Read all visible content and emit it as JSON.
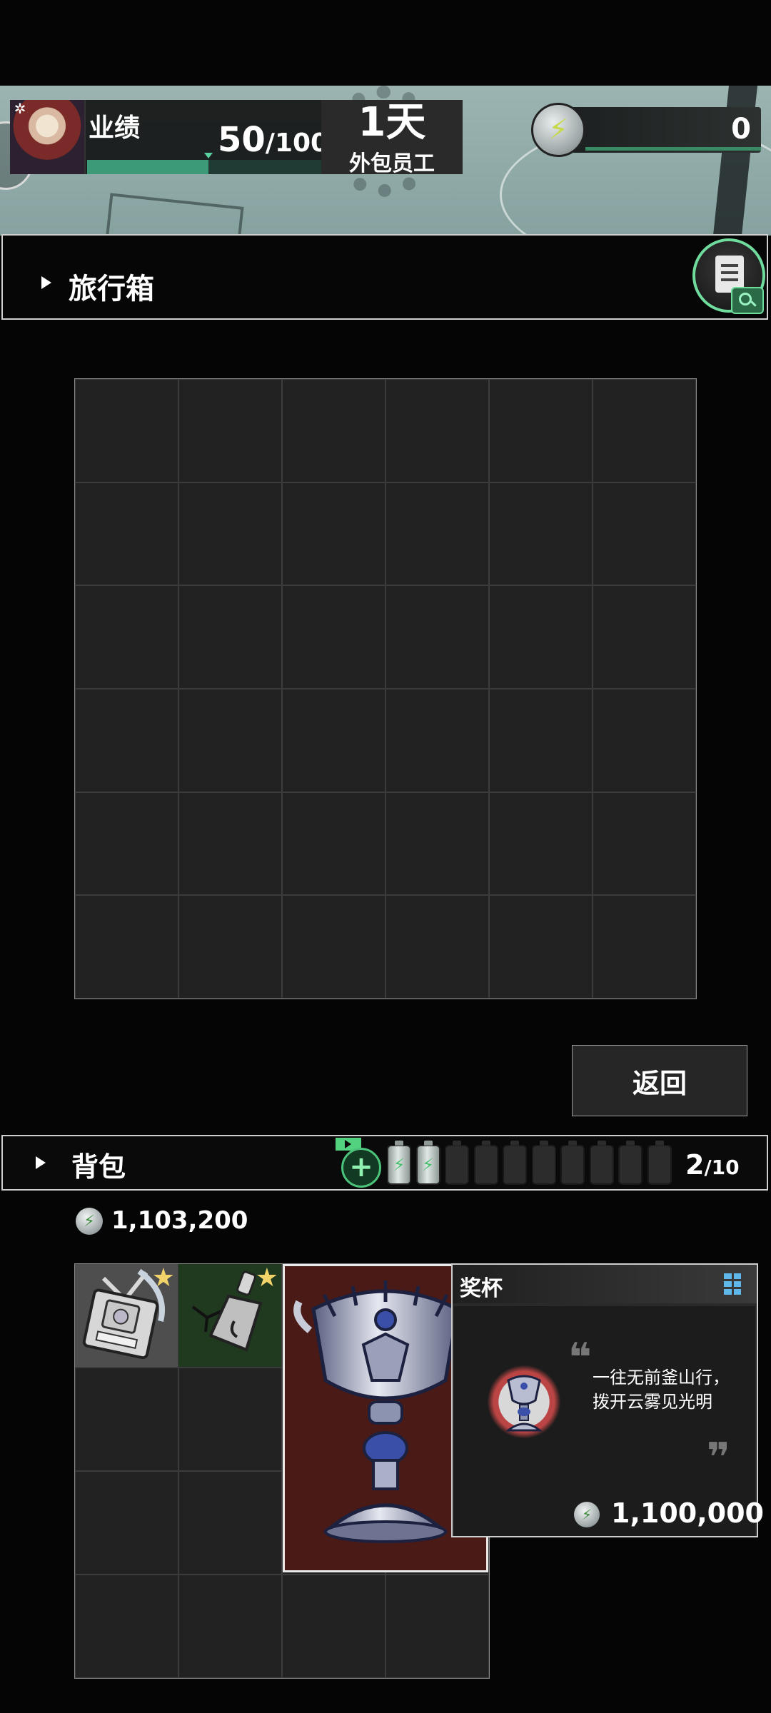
{
  "hud": {
    "performance_label": "业绩",
    "performance_value": "50",
    "performance_max": "/100",
    "performance_progress": 0.5,
    "day_value": "1天",
    "role": "外包员工",
    "energy_value": "0"
  },
  "suitcase": {
    "title": "旅行箱",
    "grid_rows": 6,
    "grid_cols": 6
  },
  "back_button": "返回",
  "backpack": {
    "title": "背包",
    "slots_used": "2",
    "slots_total": "/10",
    "batteries": [
      "full",
      "full",
      "empty",
      "empty",
      "empty",
      "empty",
      "empty",
      "empty",
      "empty",
      "empty"
    ],
    "money": "1,103,200",
    "grid_rows": 4,
    "grid_cols": 4,
    "items": [
      {
        "name": "工作证",
        "starred": true
      },
      {
        "name": "bell-item",
        "starred": true
      },
      {
        "name": "奖杯",
        "starred": false
      }
    ]
  },
  "tooltip": {
    "title": "奖杯",
    "quote_line1": "一往无前釜山行，",
    "quote_line2": "拨开云雾见光明",
    "price": "1,100,000"
  },
  "colors": {
    "accent_green": "#4cc37a",
    "progress_green": "#3d9a78",
    "star_gold": "#f2d46b",
    "trophy_bg": "#4a1a17"
  }
}
